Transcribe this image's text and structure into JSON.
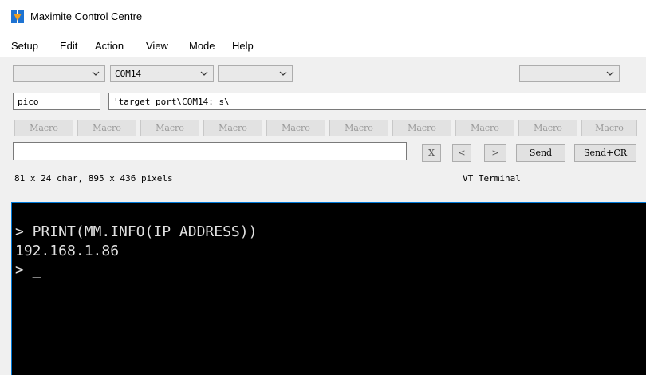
{
  "window": {
    "title": "Maximite Control Centre",
    "icon": "app-logo-icon",
    "accent": "#0078d7"
  },
  "menu": [
    "Setup",
    "Edit",
    "Action",
    "View",
    "Mode",
    "Help"
  ],
  "toolbar": {
    "combo1": "",
    "port": "COM14",
    "combo3": "",
    "combo4": ""
  },
  "target": {
    "name": "pico",
    "command": "'target port\\COM14: s\\"
  },
  "macros": [
    "Macro",
    "Macro",
    "Macro",
    "Macro",
    "Macro",
    "Macro",
    "Macro",
    "Macro",
    "Macro",
    "Macro"
  ],
  "command_input": {
    "value": ""
  },
  "buttons": {
    "clear": "X",
    "prev": "<",
    "next": ">",
    "send": "Send",
    "send_cr": "Send+CR"
  },
  "status": {
    "size": "81 x 24 char, 895 x 436 pixels",
    "mode": "VT Terminal"
  },
  "terminal": {
    "lines": [
      "> PRINT(MM.INFO(IP ADDRESS))",
      "192.168.1.86",
      "> _"
    ]
  }
}
